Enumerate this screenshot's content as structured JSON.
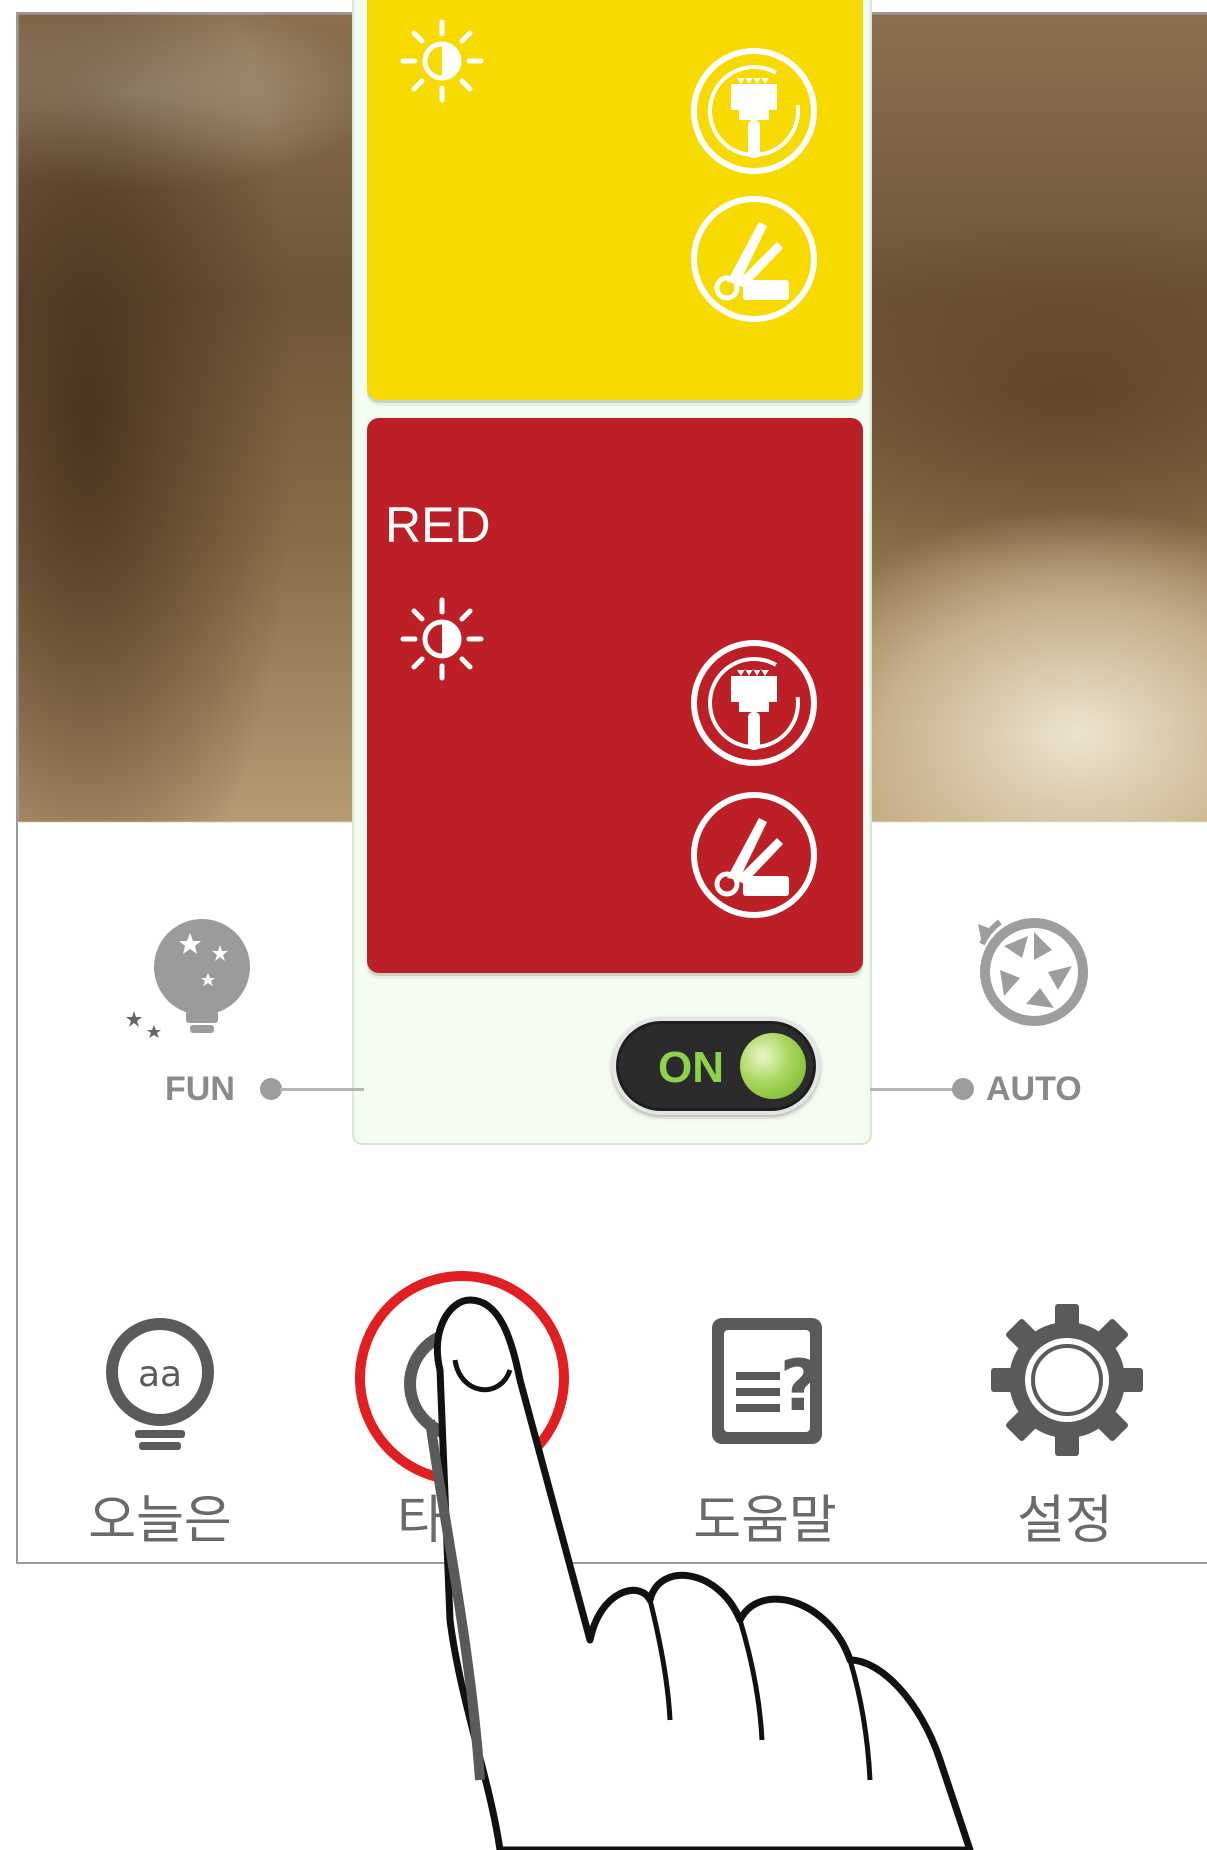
{
  "cards": [
    {
      "name": "yellow",
      "label": "",
      "color": "#f7da00"
    },
    {
      "name": "red",
      "label": "RED",
      "color": "#bd1f26"
    }
  ],
  "card_icons": [
    "brightness-icon",
    "paint-brush-icon",
    "color-palette-icon"
  ],
  "modes": {
    "left_label": "FUN",
    "right_label": "AUTO"
  },
  "toggle": {
    "label": "ON",
    "state": "on"
  },
  "bottom_nav": [
    {
      "label": "오늘은",
      "icon": "lightbulb-icon"
    },
    {
      "label": "타",
      "icon": "stopwatch-icon",
      "highlighted": true
    },
    {
      "label": "도움말",
      "icon": "help-document-icon"
    },
    {
      "label": "설정",
      "icon": "gear-icon"
    }
  ],
  "colors": {
    "highlight_ring": "#e02020",
    "toggle_green": "#8ed14a"
  }
}
